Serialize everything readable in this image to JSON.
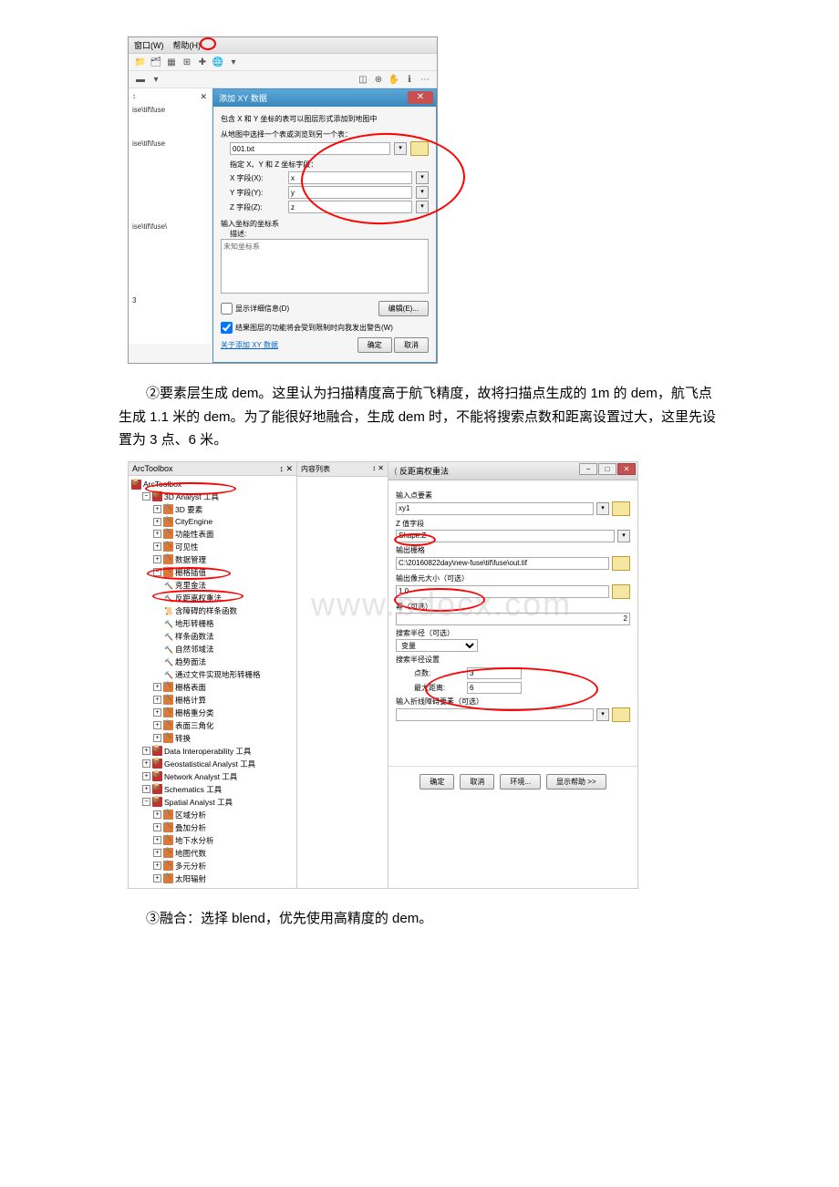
{
  "screenshot1": {
    "menubar": {
      "window": "窗口(W)",
      "help": "帮助(H)"
    },
    "panel_close": "✕",
    "panel_dock": "↕",
    "sidebar_items": [
      "ise\\tif\\fuse",
      "ise\\tif\\fuse",
      "ise\\tif\\fuse\\",
      "3"
    ],
    "dialog": {
      "title": "添加 XY 数据",
      "close": "✕",
      "hint": "包含 X 和 Y 坐标的表可以图层形式添加到地图中",
      "choose_label": "从地图中选择一个表或浏览到另一个表：",
      "table_value": "001.txt",
      "fields_header": "指定 X、Y 和 Z 坐标字段：",
      "x_label": "X 字段(X):",
      "x_value": "x",
      "y_label": "Y 字段(Y):",
      "y_value": "y",
      "z_label": "Z 字段(Z):",
      "z_value": "z",
      "coord_header": "输入坐标的坐标系",
      "desc_label": "描述:",
      "desc_value": "未知坐标系",
      "show_details_label": "显示详细信息(D)",
      "edit_btn": "编辑(E)...",
      "checkbox_label": "结果图层的功能将会受到限制时向我发出警告(W)",
      "about_link": "关于添加 XY 数据",
      "ok_btn": "确定",
      "cancel_btn": "取消"
    }
  },
  "para2": "②要素层生成 dem。这里认为扫描精度高于航飞精度，故将扫描点生成的 1m 的 dem，航飞点生成 1.1 米的 dem。为了能很好地融合，生成 dem 时，不能将搜索点数和距离设置过大，这里先设置为 3 点、6 米。",
  "screenshot2": {
    "toolbox_header": "ArcToolbox",
    "content_header": "内容列表",
    "tree": {
      "root": "ArcToolbox",
      "n1": "3D Analyst 工具",
      "n1c": [
        "3D 要素",
        "CityEngine",
        "功能性表面",
        "可见性",
        "数据管理",
        "栅格插值"
      ],
      "interp": [
        "克里金法",
        "反距离权重法",
        "含障碍的样条函数",
        "地形转栅格",
        "样条函数法",
        "自然邻域法",
        "趋势面法",
        "通过文件实现地形转栅格"
      ],
      "n1c2": [
        "栅格表面",
        "栅格计算",
        "栅格重分类",
        "表面三角化",
        "转换"
      ],
      "rest": [
        "Data Interoperability 工具",
        "Geostatistical Analyst 工具",
        "Network Analyst 工具",
        "Schematics 工具",
        "Spatial Analyst 工具"
      ],
      "spatial": [
        "区域分析",
        "叠加分析",
        "地下水分析",
        "地图代数",
        "多元分析",
        "太阳辐射"
      ]
    },
    "idw": {
      "title": "反距离权重法",
      "input_label": "输入点要素",
      "input_value": "xy1",
      "z_label": "Z 值字段",
      "z_value": "Shape.Z",
      "output_label": "输出栅格",
      "output_value": "C:\\20160822day\\new-fuse\\tif\\fuse\\out.tif",
      "cellsize_label": "输出像元大小（可选）",
      "cellsize_value": "1.0",
      "power_label": "幂（可选）",
      "power_value": "2",
      "radius_label": "搜索半径（可选）",
      "radius_value": "变量",
      "radius_settings": "搜索半径设置",
      "points_label": "点数:",
      "points_value": "3",
      "maxdist_label": "最大距离:",
      "maxdist_value": "6",
      "barrier_label": "输入折线障碍要素（可选）",
      "ok_btn": "确定",
      "cancel_btn": "取消",
      "env_btn": "环境...",
      "help_btn": "显示帮助 >>"
    }
  },
  "para3": "③融合：选择 blend，优先使用高精度的 dem。",
  "watermark": "www.bdocx.com"
}
